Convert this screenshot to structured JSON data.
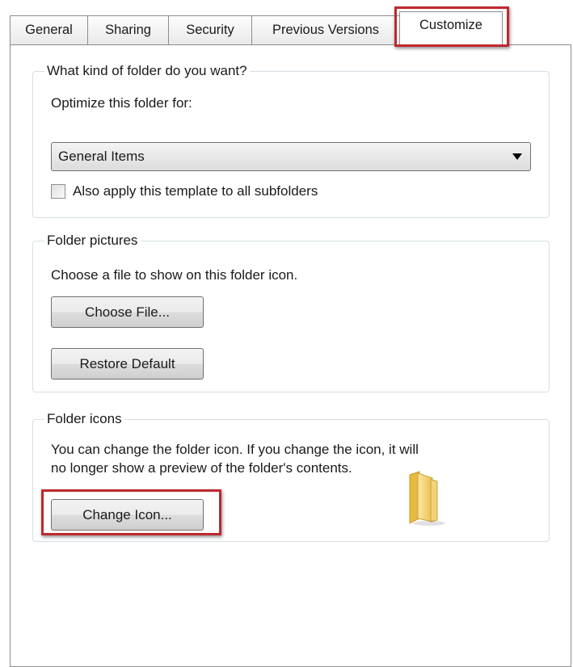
{
  "tabs": [
    {
      "label": "General"
    },
    {
      "label": "Sharing"
    },
    {
      "label": "Security"
    },
    {
      "label": "Previous Versions"
    },
    {
      "label": "Customize",
      "active": true
    }
  ],
  "folder_type": {
    "legend": "What kind of folder do you want?",
    "optimize_label": "Optimize this folder for:",
    "selected_option": "General Items",
    "checkbox_label": "Also apply this template to all subfolders",
    "checkbox_checked": false
  },
  "folder_pictures": {
    "legend": "Folder pictures",
    "description": "Choose a file to show on this folder icon.",
    "choose_file_label": "Choose File...",
    "restore_default_label": "Restore Default"
  },
  "folder_icons": {
    "legend": "Folder icons",
    "description_line1": "You can change the folder icon. If you change the icon, it will",
    "description_line2": "no longer show a preview of the folder's contents.",
    "change_icon_label": "Change Icon...",
    "icon": "folder-icon"
  },
  "colors": {
    "highlight": "#c0282e",
    "group_border": "#d5dfe5",
    "folder_yellow": "#f5d76e"
  }
}
